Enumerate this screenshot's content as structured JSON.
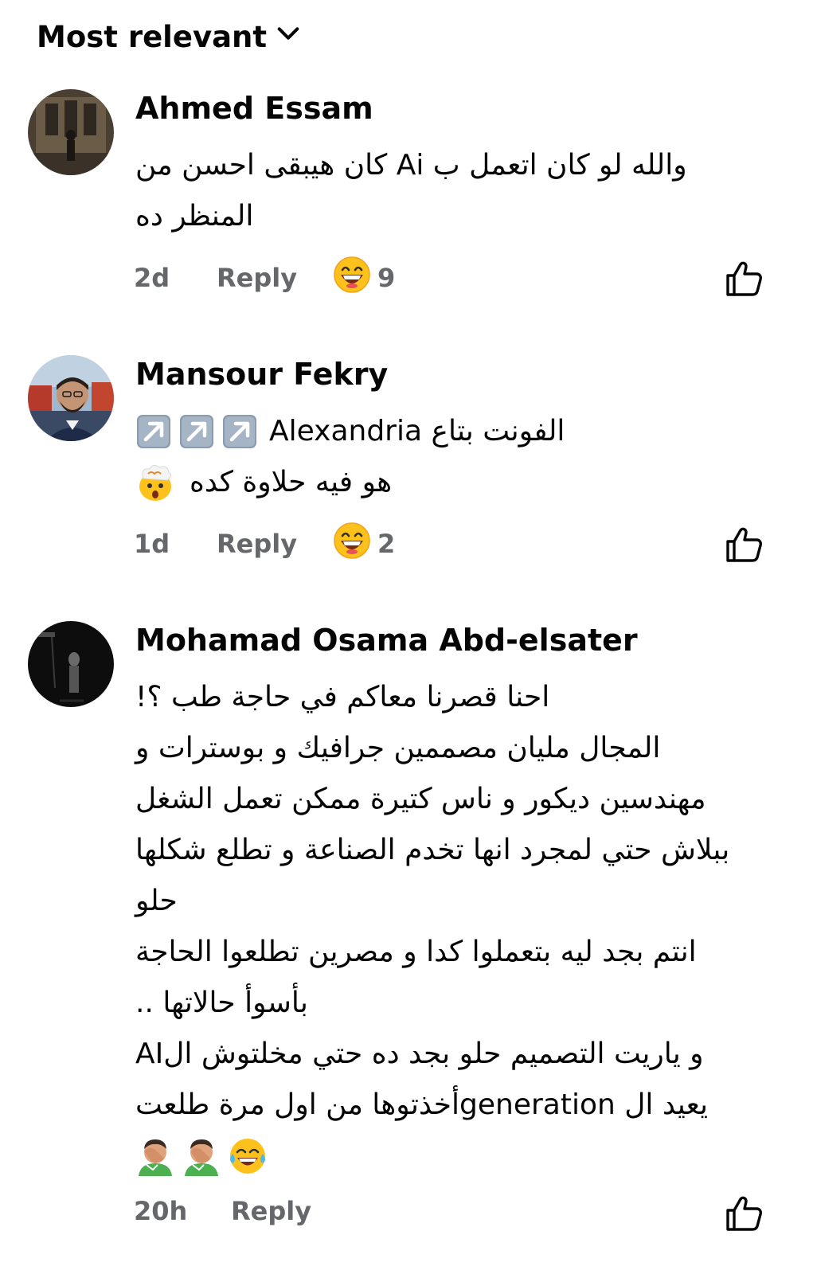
{
  "sort": {
    "label": "Most relevant",
    "icon": "chevron-down-icon"
  },
  "comments": [
    {
      "author": "Ahmed Essam",
      "lines": [
        "والله لو كان اتعمل ب Ai كان هيبقى احسن من",
        "المنظر ده"
      ],
      "time": "2d",
      "reply_label": "Reply",
      "reaction_icon": "laughing-emoji-icon",
      "reaction_count": "9",
      "like_icon": "thumbs-up-icon"
    },
    {
      "author": "Mansour Fekry",
      "lines": [
        "الفونت بتاع Alexandria",
        "هو فيه حلاوة كده"
      ],
      "line_emojis": [
        "up-right-arrow-emoji",
        "up-right-arrow-emoji",
        "up-right-arrow-emoji",
        "exploding-head-emoji"
      ],
      "time": "1d",
      "reply_label": "Reply",
      "reaction_icon": "laughing-emoji-icon",
      "reaction_count": "2",
      "like_icon": "thumbs-up-icon"
    },
    {
      "author": "Mohamad Osama Abd-elsater",
      "lines": [
        "احنا قصرنا معاكم في حاجة طب ؟!",
        "المجال مليان مصممين جرافيك و بوسترات و",
        "مهندسين ديكور و ناس كتيرة ممكن تعمل الشغل",
        "ببلاش حتي لمجرد انها تخدم الصناعة و تطلع شكلها",
        "حلو",
        "انتم بجد ليه بتعملوا كدا و مصرين تطلعوا الحاجة",
        "بأسوأ حالاتها ..",
        "و ياريت التصميم حلو بجد ده حتي مخلتوش الAI",
        "يعيد ال generationأخذتوها من اول مرة طلعت"
      ],
      "line_emojis": [
        "face-palm-emoji",
        "face-palm-emoji",
        "tears-of-joy-emoji"
      ],
      "time": "20h",
      "reply_label": "Reply",
      "like_icon": "thumbs-up-icon"
    }
  ],
  "colors": {
    "text": "#050505",
    "meta": "#65676b",
    "emoji_yellow": "#fcc21b",
    "arrow_tile": "#8a9bb0"
  }
}
